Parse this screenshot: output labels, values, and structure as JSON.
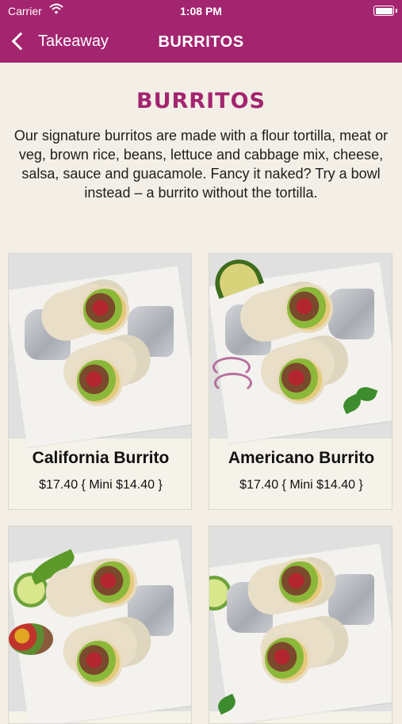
{
  "status": {
    "carrier": "Carrier",
    "time": "1:08 PM"
  },
  "nav": {
    "back_label": "Takeaway",
    "title": "BURRITOS"
  },
  "page": {
    "heading": "BURRITOS",
    "intro": "Our signature burritos are made with a flour tortilla, meat or veg, brown rice, beans, lettuce and cabbage mix, cheese, salsa, sauce and guacamole. Fancy it naked? Try a bowl instead – a burrito without the tortilla."
  },
  "colors": {
    "brand": "#a3246f",
    "background": "#f3efe6",
    "card_border": "#dcd6cb"
  },
  "products": [
    {
      "name": "California Burrito",
      "price": "$17.40 { Mini $14.40 }"
    },
    {
      "name": "Americano Burrito",
      "price": "$17.40 { Mini $14.40 }"
    },
    {
      "name": "",
      "price": ""
    },
    {
      "name": "",
      "price": ""
    }
  ]
}
